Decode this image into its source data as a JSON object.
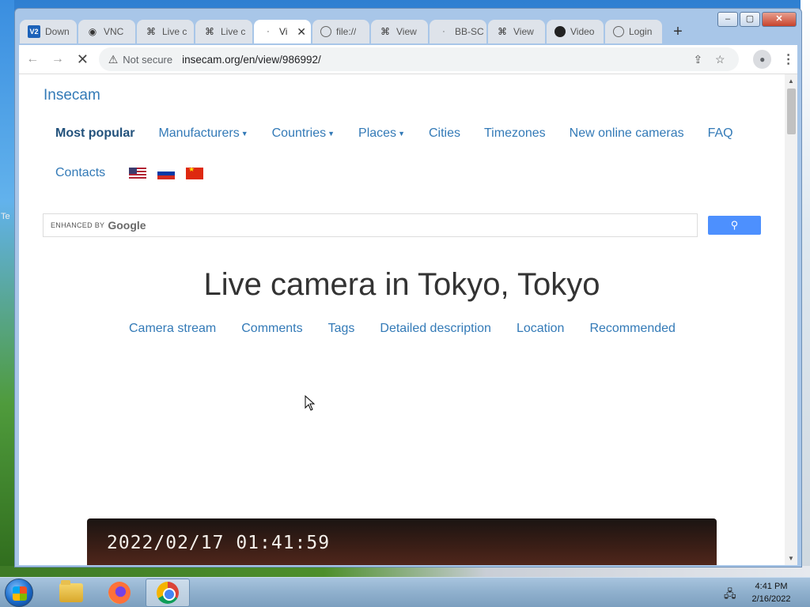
{
  "desktop": {
    "edge_text": "Te"
  },
  "window": {
    "minimize": "‒",
    "maximize": "▢",
    "close": "✕"
  },
  "tabs": [
    {
      "label": "Down",
      "icon": "v2-icon",
      "icon_text": "V2"
    },
    {
      "label": "VNC",
      "icon": "vnc-icon"
    },
    {
      "label": "Live c",
      "icon": "camera-icon"
    },
    {
      "label": "Live c",
      "icon": "camera-icon"
    },
    {
      "label": "Vi",
      "icon": "loading-icon",
      "active": true
    },
    {
      "label": "file://",
      "icon": "globe-icon"
    },
    {
      "label": "View",
      "icon": "camera-icon"
    },
    {
      "label": "BB-SC",
      "icon": "loading-icon"
    },
    {
      "label": "View",
      "icon": "camera-icon"
    },
    {
      "label": "Video",
      "icon": "video-icon"
    },
    {
      "label": "Login",
      "icon": "globe-icon"
    }
  ],
  "toolbar": {
    "security": "Not secure",
    "url": "insecam.org/en/view/986992/"
  },
  "site": {
    "brand": "Insecam",
    "nav": {
      "most_popular": "Most popular",
      "manufacturers": "Manufacturers",
      "countries": "Countries",
      "places": "Places",
      "cities": "Cities",
      "timezones": "Timezones",
      "new_online": "New online cameras",
      "faq": "FAQ",
      "contacts": "Contacts"
    },
    "search": {
      "enhanced_by": "ENHANCED BY",
      "google": "Google"
    },
    "heading": "Live camera in Tokyo, Tokyo",
    "subnav": {
      "camera_stream": "Camera stream",
      "comments": "Comments",
      "tags": "Tags",
      "detailed_description": "Detailed description",
      "location": "Location",
      "recommended": "Recommended"
    },
    "camera_timestamp": "2022/02/17  01:41:59"
  },
  "taskbar": {
    "time": "4:41 PM",
    "date": "2/16/2022"
  },
  "colors": {
    "link": "#337ab7",
    "search_button": "#4d90fe"
  }
}
